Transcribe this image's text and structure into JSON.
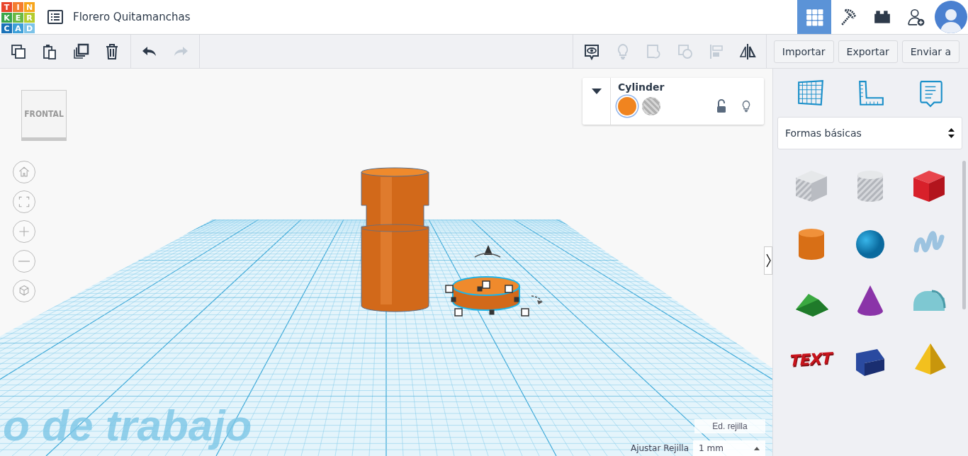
{
  "header": {
    "logo_letters": [
      "T",
      "I",
      "N",
      "K",
      "E",
      "R",
      "C",
      "A",
      "D"
    ],
    "title": "Florero Quitamanchas",
    "nav": [
      {
        "kind": "grid",
        "selected": true
      },
      {
        "kind": "pickaxe",
        "selected": false
      },
      {
        "kind": "brick",
        "selected": false
      },
      {
        "kind": "add-user",
        "selected": false
      }
    ]
  },
  "toolbar": {
    "edit": [
      {
        "kind": "copy",
        "disabled": false
      },
      {
        "kind": "paste",
        "disabled": false
      },
      {
        "kind": "duplicate",
        "disabled": false
      },
      {
        "kind": "delete",
        "disabled": false
      }
    ],
    "history": [
      {
        "kind": "undo",
        "disabled": false
      },
      {
        "kind": "redo",
        "disabled": true
      }
    ],
    "tools": [
      {
        "kind": "notes",
        "disabled": false
      },
      {
        "kind": "bulb",
        "disabled": true
      },
      {
        "kind": "group",
        "disabled": true
      },
      {
        "kind": "ungroup",
        "disabled": true
      },
      {
        "kind": "align",
        "disabled": true
      },
      {
        "kind": "mirror",
        "disabled": false
      }
    ],
    "actions": [
      "Importar",
      "Exportar",
      "Enviar a"
    ]
  },
  "view_cube": {
    "face": "FRONTAL"
  },
  "view_controls": [
    {
      "kind": "home"
    },
    {
      "kind": "fit"
    },
    {
      "kind": "zoom-in"
    },
    {
      "kind": "zoom-out"
    },
    {
      "kind": "ortho"
    }
  ],
  "inspector": {
    "shape_name": "Cylinder",
    "modes": [
      {
        "kind": "solid",
        "selected": true
      },
      {
        "kind": "hole",
        "selected": false
      }
    ],
    "locked": false
  },
  "workplane": {
    "label": "o de trabajo",
    "edit_grid": "Ed. rejilla",
    "snap_label": "Ajustar Rejilla",
    "snap_value": "1 mm"
  },
  "panel": {
    "tabs": [
      {
        "kind": "workplane"
      },
      {
        "kind": "ruler"
      },
      {
        "kind": "notes"
      }
    ],
    "category": "Formas básicas",
    "shapes": [
      {
        "kind": "box-hole"
      },
      {
        "kind": "cylinder-hole"
      },
      {
        "kind": "box"
      },
      {
        "kind": "cylinder"
      },
      {
        "kind": "sphere"
      },
      {
        "kind": "scribble"
      },
      {
        "kind": "roof"
      },
      {
        "kind": "cone"
      },
      {
        "kind": "round-roof"
      },
      {
        "kind": "text",
        "label": "TEXT"
      },
      {
        "kind": "wedge"
      },
      {
        "kind": "pyramid"
      }
    ]
  }
}
